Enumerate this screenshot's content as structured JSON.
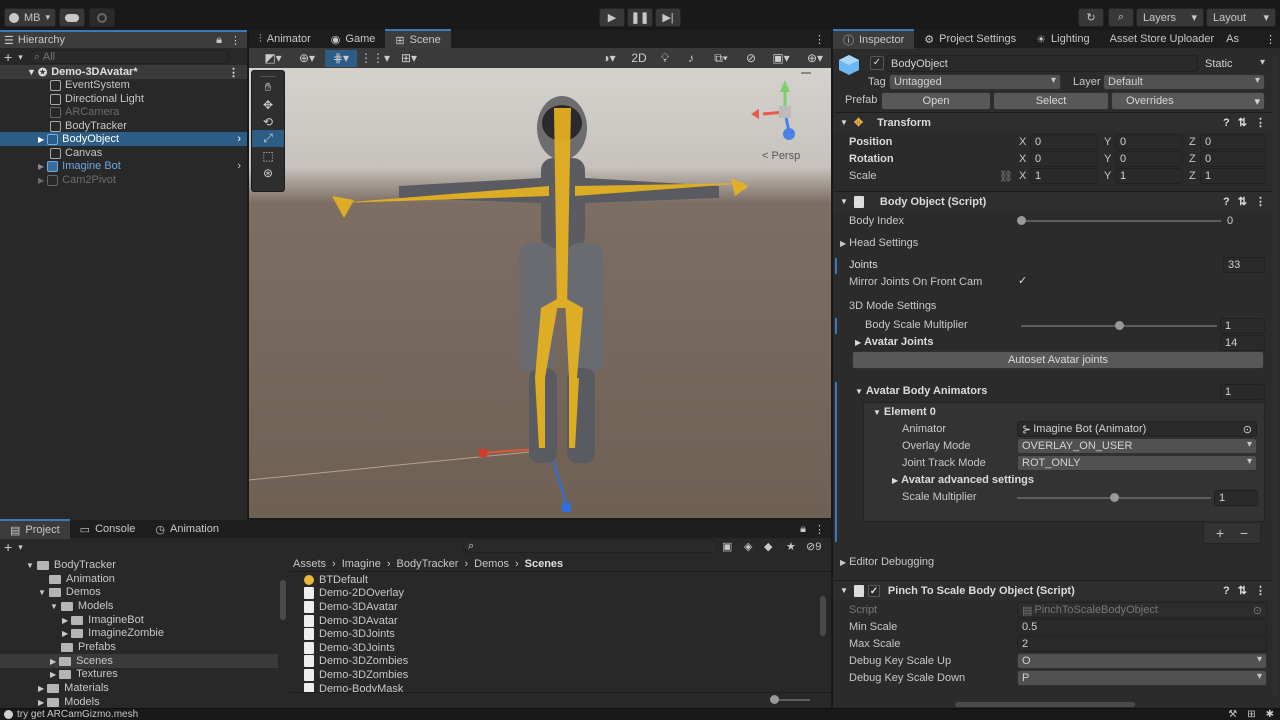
{
  "toolbar": {
    "account": "MB",
    "layers": "Layers",
    "layout": "Layout"
  },
  "hierarchy": {
    "tab": "Hierarchy",
    "search_placeholder": "All",
    "items": [
      {
        "label": "Demo-3DAvatar*"
      },
      {
        "label": "EventSystem"
      },
      {
        "label": "Directional Light"
      },
      {
        "label": "ARCamera"
      },
      {
        "label": "BodyTracker"
      },
      {
        "label": "BodyObject"
      },
      {
        "label": "Canvas"
      },
      {
        "label": "Imagine Bot"
      },
      {
        "label": "Cam2Pivot"
      }
    ]
  },
  "center_tabs": {
    "animator": "Animator",
    "game": "Game",
    "scene": "Scene"
  },
  "scene": {
    "mode_2d": "2D",
    "persp": "< Persp"
  },
  "inspector": {
    "tabs": [
      "Inspector",
      "Project Settings",
      "Lighting",
      "Asset Store Uploader",
      "As"
    ],
    "object_name": "BodyObject",
    "static_label": "Static",
    "tag_label": "Tag",
    "tag_value": "Untagged",
    "layer_label": "Layer",
    "layer_value": "Default",
    "prefab_label": "Prefab",
    "open": "Open",
    "select": "Select",
    "overrides": "Overrides",
    "transform": {
      "title": "Transform",
      "position_label": "Position",
      "rotation_label": "Rotation",
      "scale_label": "Scale",
      "x": "X",
      "y": "Y",
      "z": "Z",
      "position": [
        "0",
        "0",
        "0"
      ],
      "rotation": [
        "0",
        "0",
        "0"
      ],
      "scale": [
        "1",
        "1",
        "1"
      ]
    },
    "body_object": {
      "title": "Body Object (Script)",
      "body_index_label": "Body Index",
      "body_index": "0",
      "body_index_frac": 0,
      "head_settings": "Head Settings",
      "joints_label": "Joints",
      "joints": "33",
      "mirror_label": "Mirror Joints On Front Cam",
      "mode_settings": "3D Mode Settings",
      "body_scale_label": "Body Scale Multiplier",
      "body_scale": "1",
      "body_scale_frac": 0.5,
      "avatar_joints_label": "Avatar Joints",
      "avatar_joints": "14",
      "autoset": "Autoset Avatar joints",
      "animators_label": "Avatar Body Animators",
      "animators_count": "1",
      "element_label": "Element 0",
      "animator_label": "Animator",
      "animator_value": "Imagine Bot (Animator)",
      "overlay_label": "Overlay Mode",
      "overlay_value": "OVERLAY_ON_USER",
      "joint_track_label": "Joint Track Mode",
      "joint_track_value": "ROT_ONLY",
      "adv_label": "Avatar advanced settings",
      "scale_mult_label": "Scale Multiplier",
      "scale_mult": "1",
      "scale_mult_frac": 0.5,
      "plus": "+",
      "minus": "−"
    },
    "editor_debugging": "Editor Debugging",
    "pinch": {
      "title": "Pinch To Scale Body Object (Script)",
      "script_label": "Script",
      "script_value": "PinchToScaleBodyObject",
      "min_label": "Min Scale",
      "min": "0.5",
      "max_label": "Max Scale",
      "max": "2",
      "up_label": "Debug Key Scale Up",
      "up": "O",
      "down_label": "Debug Key Scale Down",
      "down": "P"
    }
  },
  "project": {
    "tabs": [
      "Project",
      "Console",
      "Animation"
    ],
    "count": "9",
    "breadcrumb": [
      "Assets",
      "Imagine",
      "BodyTracker",
      "Demos",
      "Scenes"
    ],
    "tree": [
      {
        "label": "BodyTracker"
      },
      {
        "label": "Animation"
      },
      {
        "label": "Demos"
      },
      {
        "label": "Models"
      },
      {
        "label": "ImagineBot"
      },
      {
        "label": "ImagineZombie"
      },
      {
        "label": "Prefabs"
      },
      {
        "label": "Scenes"
      },
      {
        "label": "Textures"
      },
      {
        "label": "Materials"
      },
      {
        "label": "Models"
      }
    ],
    "files": [
      {
        "label": "BTDefault"
      },
      {
        "label": "Demo-2DOverlay"
      },
      {
        "label": "Demo-3DAvatar"
      },
      {
        "label": "Demo-3DAvatar"
      },
      {
        "label": "Demo-3DJoints"
      },
      {
        "label": "Demo-3DJoints"
      },
      {
        "label": "Demo-3DZombies"
      },
      {
        "label": "Demo-3DZombies"
      },
      {
        "label": "Demo-BodyMask"
      }
    ]
  },
  "status": {
    "message": "try get ARCamGizmo.mesh"
  }
}
